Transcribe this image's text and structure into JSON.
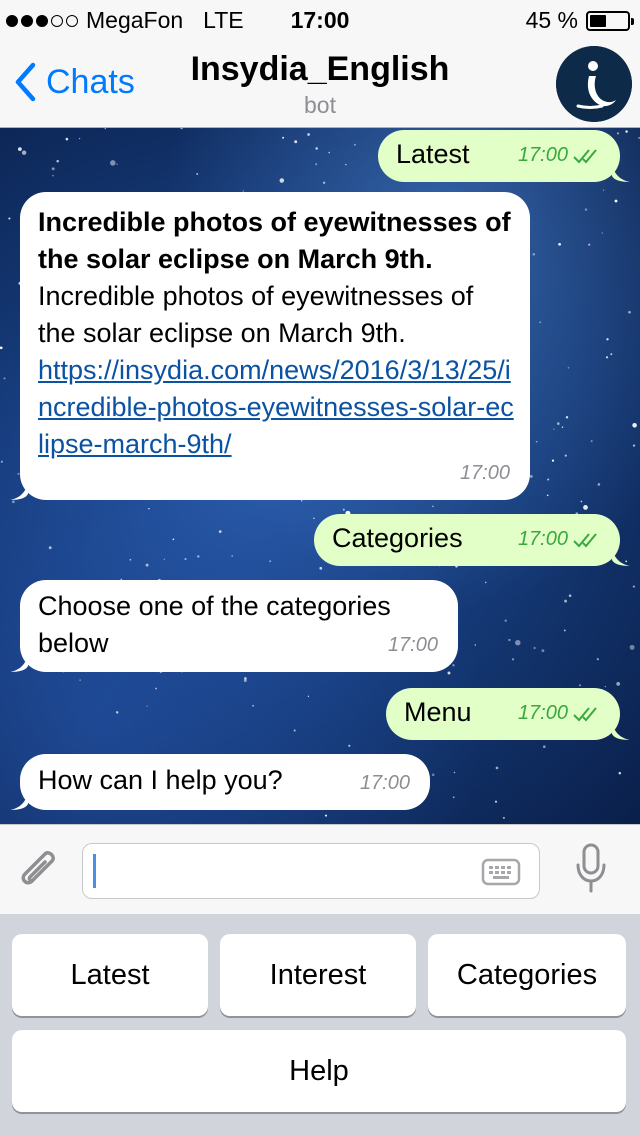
{
  "status_bar": {
    "carrier": "MegaFon",
    "network": "LTE",
    "time": "17:00",
    "battery": "45 %",
    "battery_level": 0.45
  },
  "nav": {
    "back_label": "Chats",
    "title": "Insydia_English",
    "subtitle": "bot"
  },
  "messages": [
    {
      "dir": "out",
      "text": "Latest",
      "time": "17:00"
    },
    {
      "dir": "in",
      "bold": "Incredible photos of eyewitnesses of the solar eclipse on March 9th.",
      "text": "Incredible photos of eyewitnesses of the solar eclipse on March 9th.",
      "link": "https://insydia.com/news/2016/3/13/25/incredible-photos-eyewitnesses-solar-eclipse-march-9th/",
      "time": "17:00"
    },
    {
      "dir": "out",
      "text": "Categories",
      "time": "17:00"
    },
    {
      "dir": "in",
      "text": "Choose one of the categories below",
      "time": "17:00"
    },
    {
      "dir": "out",
      "text": "Menu",
      "time": "17:00"
    },
    {
      "dir": "in",
      "text": "How can I help you?",
      "time": "17:00"
    }
  ],
  "input": {
    "placeholder": ""
  },
  "keyboard": {
    "buttons": [
      "Latest",
      "Interest",
      "Categories",
      "Help"
    ]
  },
  "colors": {
    "accent": "#007aff",
    "outgoing_bubble": "#e1ffc7",
    "incoming_bubble": "#ffffff",
    "read_check": "#3aa83f",
    "link": "#0b52a3"
  }
}
